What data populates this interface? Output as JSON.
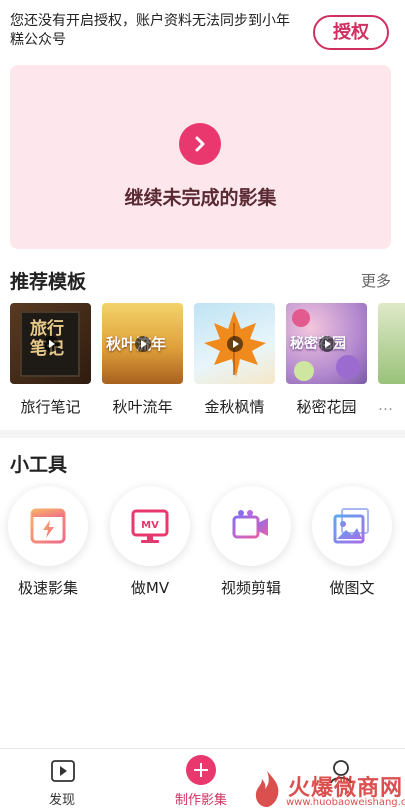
{
  "auth_banner": {
    "message": "您还没有开启授权，账户资料无法同步到小年糕公众号",
    "button_label": "授权"
  },
  "continue_card": {
    "label": "继续未完成的影集"
  },
  "recommended": {
    "title": "推荐模板",
    "more_label": "更多",
    "templates": [
      {
        "label": "旅行笔记",
        "thumb_text": "旅行笔记"
      },
      {
        "label": "秋叶流年",
        "thumb_text": "秋叶流年"
      },
      {
        "label": "金秋枫情",
        "thumb_text": ""
      },
      {
        "label": "秘密花园",
        "thumb_text": "秘密花园"
      },
      {
        "label": "…",
        "thumb_text": ""
      }
    ]
  },
  "tools": {
    "title": "小工具",
    "items": [
      {
        "label": "极速影集",
        "icon": "lightning-album-icon"
      },
      {
        "label": "做MV",
        "icon": "mv-screen-icon"
      },
      {
        "label": "视频剪辑",
        "icon": "video-camera-icon"
      },
      {
        "label": "做图文",
        "icon": "image-text-icon"
      }
    ]
  },
  "bottom_nav": {
    "items": [
      {
        "label": "发现",
        "icon": "play-square-icon"
      },
      {
        "label": "制作影集",
        "icon": "plus-circle-icon"
      },
      {
        "label": "",
        "icon": "user-icon"
      }
    ]
  },
  "watermark": {
    "text": "火爆微商网",
    "url": "www.huobaoweishang.com"
  },
  "colors": {
    "accent": "#e8386e",
    "accent_text": "#d0305f",
    "card_bg": "#fde7ec"
  }
}
